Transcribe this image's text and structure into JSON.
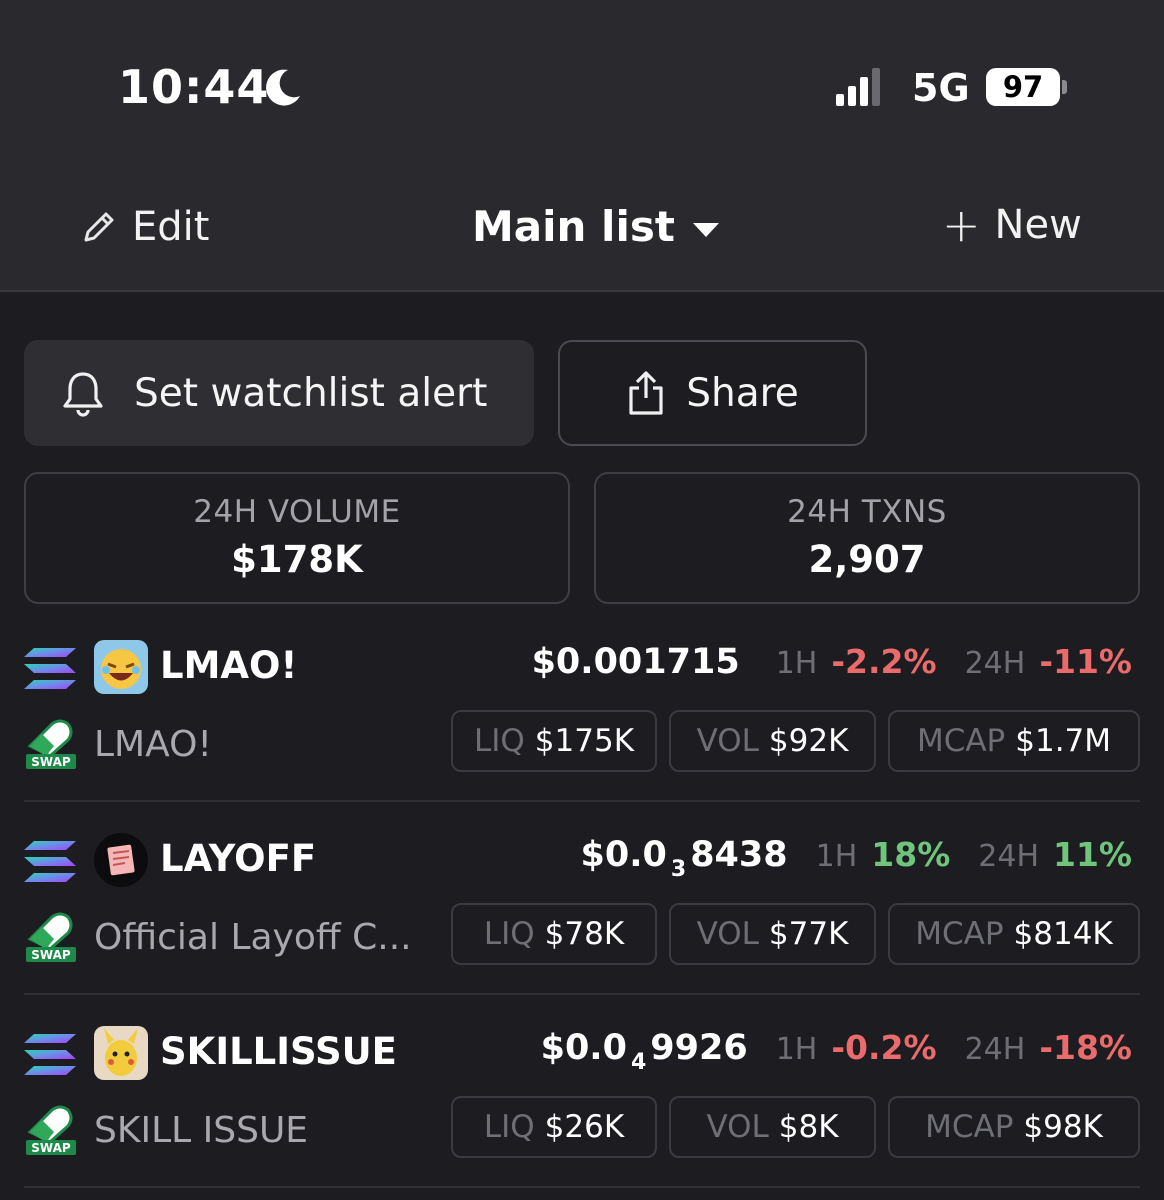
{
  "status_bar": {
    "time": "10:44",
    "network": "5G",
    "battery": "97",
    "icons": [
      "moon-icon",
      "signal-icon"
    ]
  },
  "nav": {
    "edit_label": "Edit",
    "list_title": "Main list",
    "new_label": "New",
    "icons": [
      "pencil-icon",
      "chevron-down-icon",
      "plus-icon"
    ]
  },
  "actions": {
    "alert_label": "Set watchlist alert",
    "share_label": "Share",
    "icons": [
      "bell-icon",
      "share-icon"
    ]
  },
  "stats": [
    {
      "label": "24H VOLUME",
      "value": "$178K"
    },
    {
      "label": "24H TXNS",
      "value": "2,907"
    }
  ],
  "colors": {
    "negative": "#ea6b6b",
    "positive": "#6fc57c",
    "background": "#1c1c21",
    "header": "#2a2a2e"
  },
  "tokens": [
    {
      "symbol": "LMAO!",
      "name": "LMAO!",
      "swap_label": "SWAP",
      "price_main": "$0.001715",
      "price_sub": "",
      "price_tail": "",
      "h1_label": "1H",
      "h1": "-2.2%",
      "h1_dir": "neg",
      "h24_label": "24H",
      "h24": "-11%",
      "h24_dir": "neg",
      "liq_label": "LIQ",
      "liq": "$175K",
      "vol_label": "VOL",
      "vol": "$92K",
      "mcap_label": "MCAP",
      "mcap": "$1.7M"
    },
    {
      "symbol": "LAYOFF",
      "name": "Official Layoff C...",
      "swap_label": "SWAP",
      "price_main": "$0.0",
      "price_sub": "3",
      "price_tail": "8438",
      "h1_label": "1H",
      "h1": "18%",
      "h1_dir": "pos",
      "h24_label": "24H",
      "h24": "11%",
      "h24_dir": "pos",
      "liq_label": "LIQ",
      "liq": "$78K",
      "vol_label": "VOL",
      "vol": "$77K",
      "mcap_label": "MCAP",
      "mcap": "$814K"
    },
    {
      "symbol": "SKILLISSUE",
      "name": "SKILL ISSUE",
      "swap_label": "SWAP",
      "price_main": "$0.0",
      "price_sub": "4",
      "price_tail": "9926",
      "h1_label": "1H",
      "h1": "-0.2%",
      "h1_dir": "neg",
      "h24_label": "24H",
      "h24": "-18%",
      "h24_dir": "neg",
      "liq_label": "LIQ",
      "liq": "$26K",
      "vol_label": "VOL",
      "vol": "$8K",
      "mcap_label": "MCAP",
      "mcap": "$98K"
    }
  ]
}
